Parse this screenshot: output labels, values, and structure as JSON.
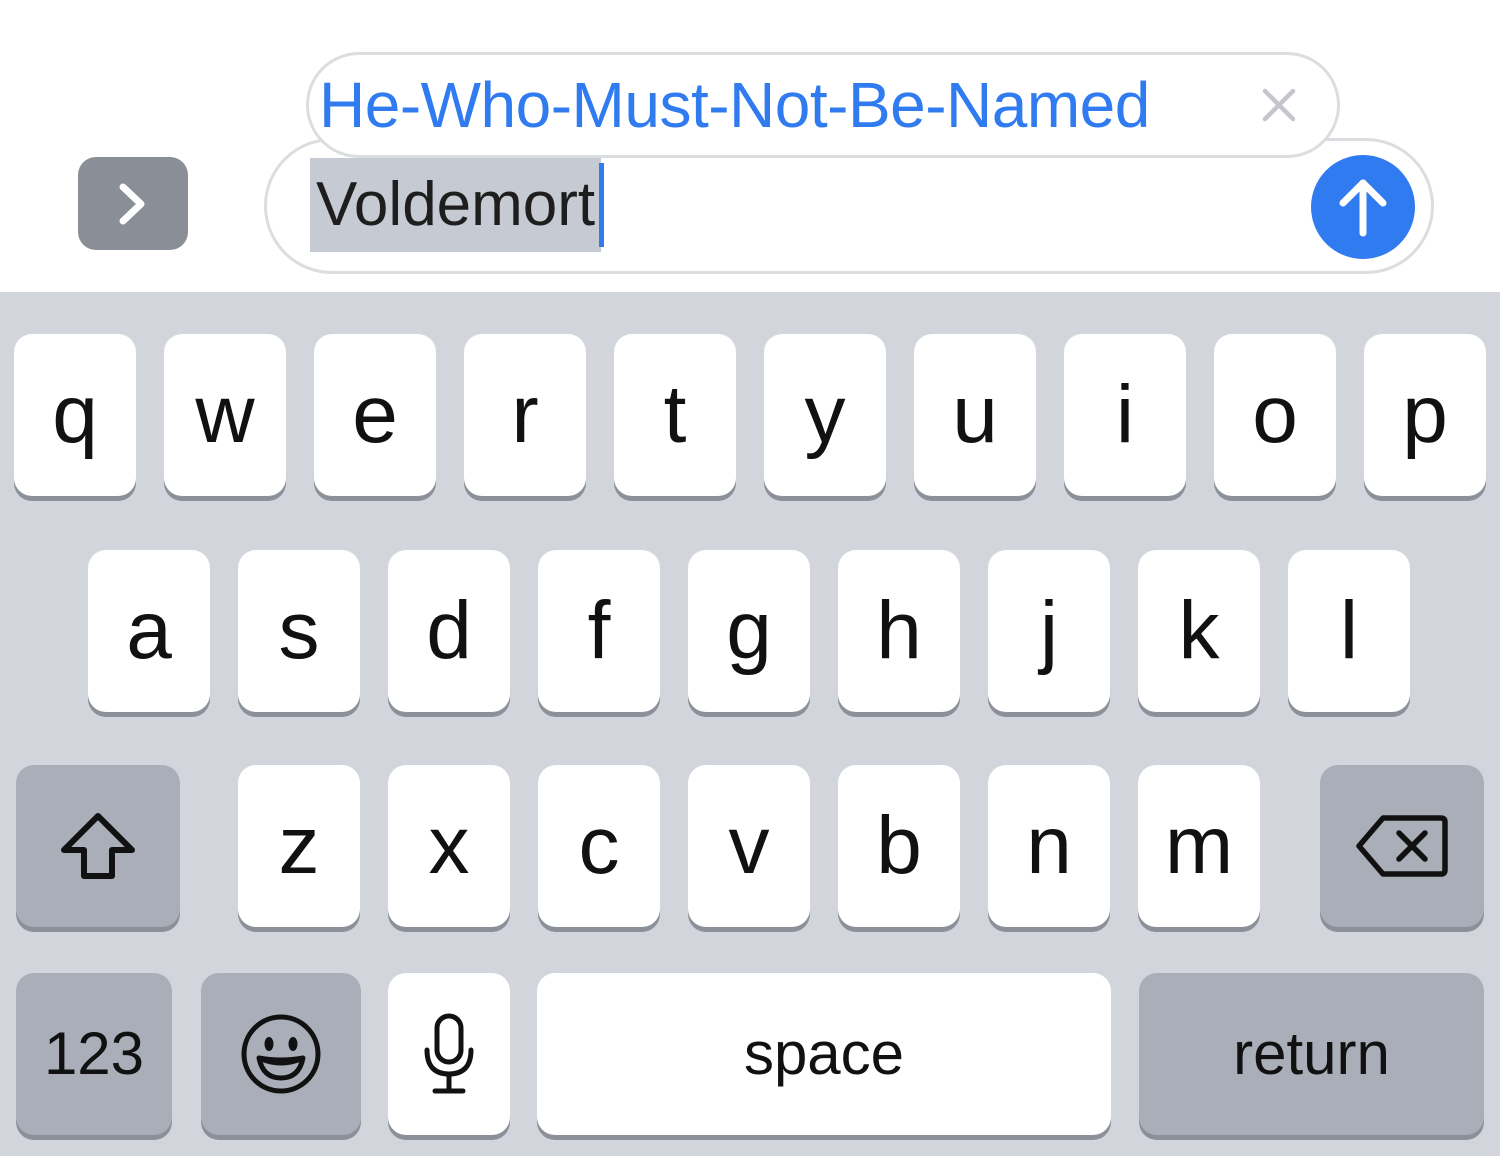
{
  "compose": {
    "expand_icon": "chevron-right-icon",
    "suggestion_text": "He-Who-Must-Not-Be-Named",
    "suggestion_close_icon": "close-icon",
    "typed_text": "Voldemort",
    "send_icon": "arrow-up-icon"
  },
  "keyboard": {
    "row1": [
      "q",
      "w",
      "e",
      "r",
      "t",
      "y",
      "u",
      "i",
      "o",
      "p"
    ],
    "row2": [
      "a",
      "s",
      "d",
      "f",
      "g",
      "h",
      "j",
      "k",
      "l"
    ],
    "row3": [
      "z",
      "x",
      "c",
      "v",
      "b",
      "n",
      "m"
    ],
    "shift_icon": "shift-icon",
    "delete_icon": "backspace-icon",
    "numbers_label": "123",
    "emoji_icon": "emoji-icon",
    "mic_icon": "microphone-icon",
    "space_label": "space",
    "return_label": "return"
  },
  "colors": {
    "accent": "#2f7bef",
    "keyboard_bg": "#d2d5db",
    "key_light": "#ffffff",
    "key_dark": "#a9aeb8"
  }
}
